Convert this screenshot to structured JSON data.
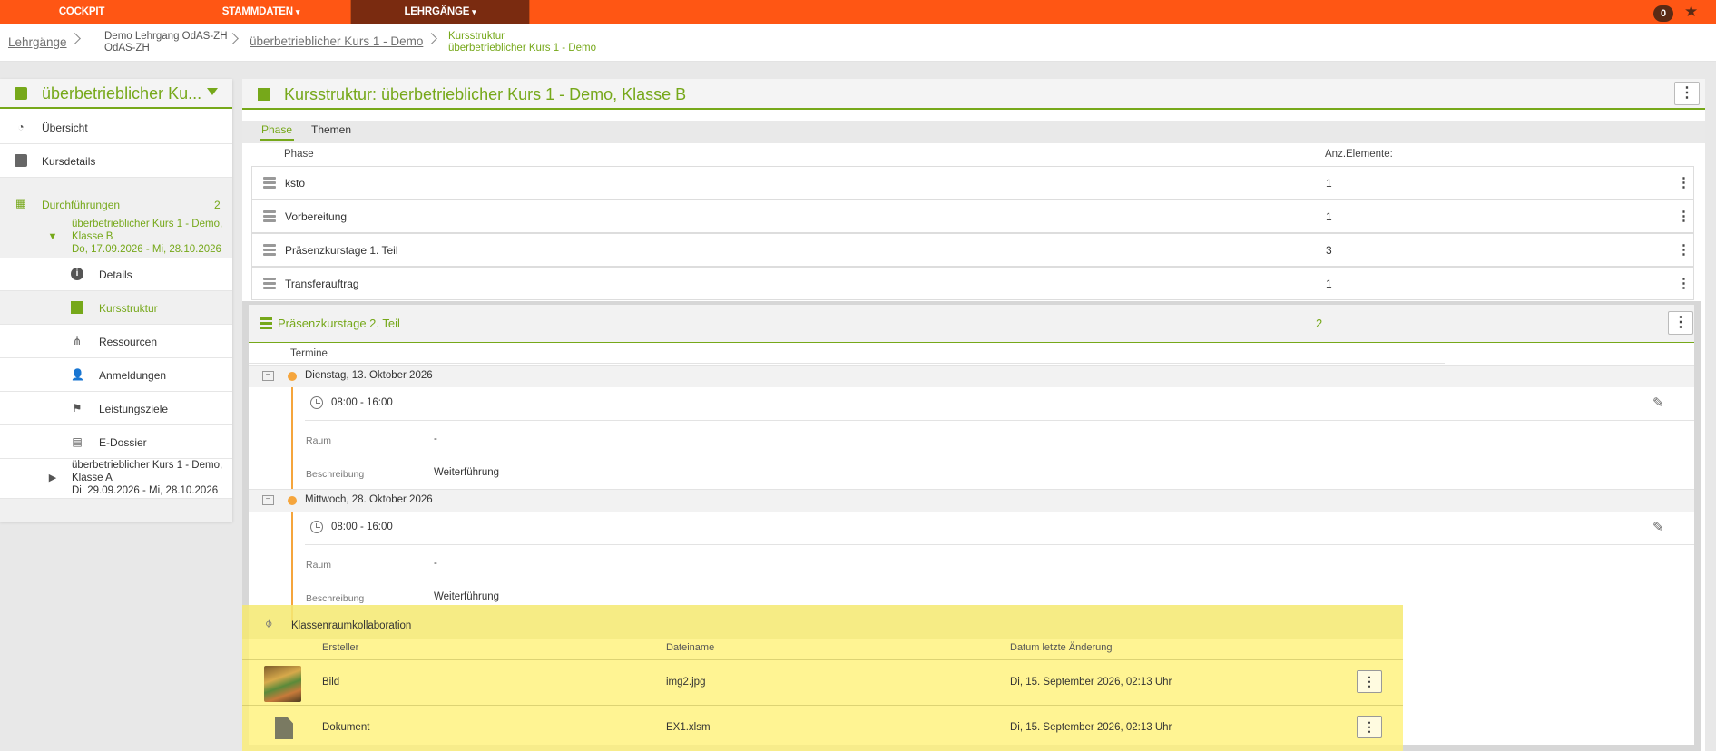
{
  "topnav": {
    "items": [
      {
        "label": "COCKPIT"
      },
      {
        "label": "STAMMDATEN",
        "caret": "▾"
      },
      {
        "label": "LEHRGÄNGE",
        "caret": "▾"
      }
    ],
    "notification_count": "0",
    "star_icon": "star-icon",
    "accent_color": "#ff5614"
  },
  "breadcrumb": {
    "root": "Lehrgänge",
    "lehrgang_line1": "Demo Lehrgang OdAS-ZH",
    "lehrgang_line2": "OdAS-ZH",
    "course": "überbetrieblicher Kurs 1 - Demo",
    "current_line1": "Kursstruktur",
    "current_line2": "überbetrieblicher Kurs 1 - Demo"
  },
  "sidebar": {
    "title": "überbetrieblicher Ku...",
    "items": [
      {
        "label": "Übersicht",
        "icon": "dashboard-icon"
      },
      {
        "label": "Kursdetails",
        "icon": "course-icon"
      }
    ],
    "durchfuehrungen": {
      "label": "Durchführungen",
      "count": "2"
    },
    "active_run": {
      "line1": "überbetrieblicher Kurs 1 - Demo,",
      "line2": "Klasse B",
      "line3": "Do, 17.09.2026 - Mi, 28.10.2026"
    },
    "sub_items": [
      {
        "label": "Details",
        "icon": "info-icon"
      },
      {
        "label": "Kursstruktur",
        "icon": "structure-icon"
      },
      {
        "label": "Ressourcen",
        "icon": "resources-icon"
      },
      {
        "label": "Anmeldungen",
        "icon": "user-icon"
      },
      {
        "label": "Leistungsziele",
        "icon": "flag-icon"
      },
      {
        "label": "E-Dossier",
        "icon": "dossier-icon"
      }
    ],
    "other_run": {
      "line1": "überbetrieblicher Kurs 1 - Demo,",
      "line2": "Klasse A",
      "line3": "Di, 29.09.2026 - Mi, 28.10.2026"
    }
  },
  "main": {
    "title": "Kursstruktur: überbetrieblicher Kurs 1 - Demo, Klasse B",
    "tabs": [
      {
        "label": "Phase"
      },
      {
        "label": "Themen"
      }
    ],
    "columns": {
      "phase": "Phase",
      "count": "Anz.Elemente:"
    },
    "phases": [
      {
        "name": "ksto",
        "count": "1"
      },
      {
        "name": "Vorbereitung",
        "count": "1"
      },
      {
        "name": "Präsenzkurstage 1. Teil",
        "count": "3"
      },
      {
        "name": "Transferauftrag",
        "count": "1"
      }
    ],
    "expanded_phase": {
      "name": "Präsenzkurstage 2. Teil",
      "count": "2",
      "termine_label": "Termine",
      "days": [
        {
          "date": "Dienstag, 13. Oktober 2026",
          "time": "08:00 - 16:00",
          "raum_label": "Raum",
          "raum": "-",
          "beschreibung_label": "Beschreibung",
          "beschreibung": "Weiterführung"
        },
        {
          "date": "Mittwoch, 28. Oktober 2026",
          "time": "08:00 - 16:00",
          "raum_label": "Raum",
          "raum": "-",
          "beschreibung_label": "Beschreibung",
          "beschreibung": "Weiterführung"
        }
      ]
    }
  },
  "collab": {
    "title": "Klassenraumkollaboration",
    "columns": {
      "creator": "Ersteller",
      "filename": "Dateiname",
      "modified": "Datum letzte Änderung"
    },
    "rows": [
      {
        "creator": "Bild",
        "filename": "img2.jpg",
        "modified": "Di, 15. September 2026, 02:13 Uhr",
        "icon": "image-thumbnail"
      },
      {
        "creator": "Dokument",
        "filename": "EX1.xlsm",
        "modified": "Di, 15. September 2026, 02:13 Uhr",
        "icon": "document-icon"
      }
    ],
    "highlight_color": "#fff178"
  }
}
